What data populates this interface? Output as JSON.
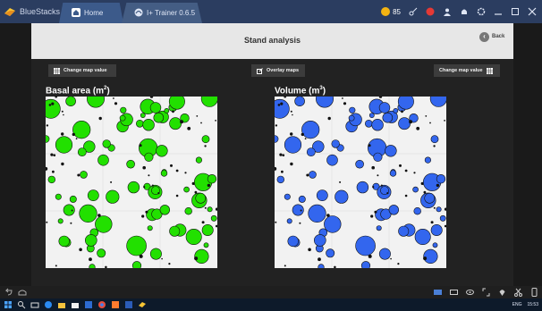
{
  "titlebar": {
    "app_name": "BlueStacks",
    "tabs": [
      {
        "label": "Home"
      },
      {
        "label": "I+ Trainer 0.6.5"
      }
    ],
    "coins": "85"
  },
  "app": {
    "title": "Stand analysis",
    "back_label": "Back",
    "buttons": {
      "change_left": "Change map value",
      "overlay": "Overlay maps",
      "change_right": "Change map value"
    },
    "panels": [
      {
        "title": "Basal area (m",
        "sup": "2",
        "close": ")",
        "color": "#22e000"
      },
      {
        "title": "Volume (m",
        "sup": "3",
        "close": ")",
        "color": "#3366ee"
      }
    ]
  },
  "taskbar": {
    "lang": "ENG",
    "time": "15:53"
  },
  "colors": {
    "titlebar": "#2b3d60",
    "tree_green": "#22e000",
    "tree_blue": "#3366ee"
  }
}
